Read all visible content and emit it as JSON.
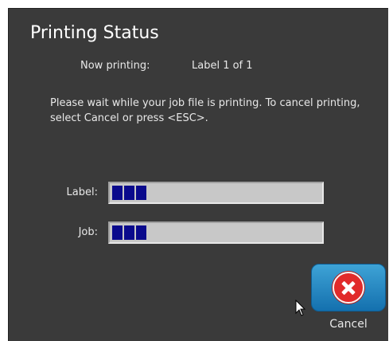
{
  "dialog": {
    "title": "Printing Status",
    "now_printing_label": "Now printing:",
    "now_printing_value": "Label 1 of 1",
    "message": "Please wait while your job file is printing. To cancel printing, select Cancel or press <ESC>."
  },
  "progress": {
    "label_row": {
      "label": "Label:",
      "value": 0.17
    },
    "job_row": {
      "label": "Job:",
      "value": 0.17
    },
    "bar_color": "#0a0a8c"
  },
  "buttons": {
    "cancel_label": "Cancel",
    "cancel_icon": "close-circle-icon"
  }
}
